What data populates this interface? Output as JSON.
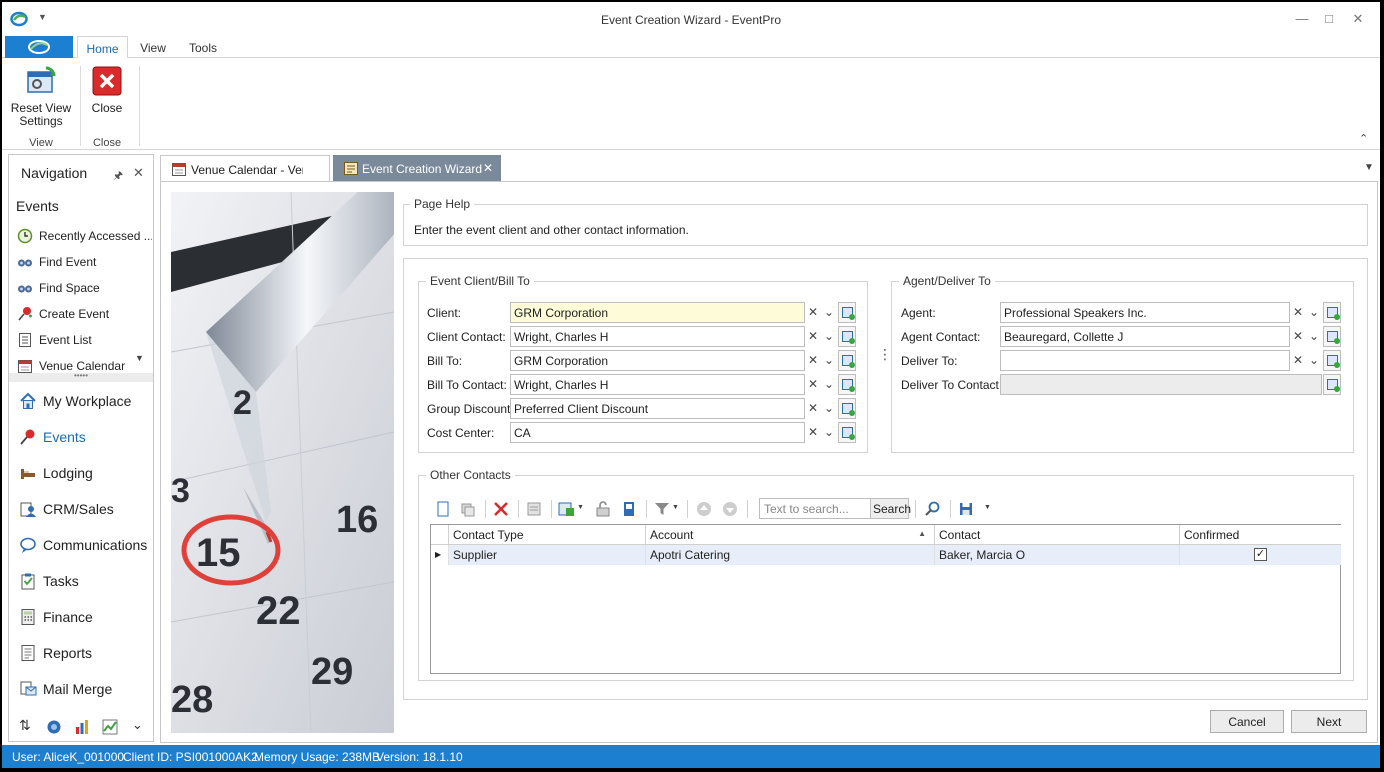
{
  "window": {
    "title": "Event Creation Wizard - EventPro"
  },
  "ribbon": {
    "tabs": [
      {
        "label": "Home"
      },
      {
        "label": "View"
      },
      {
        "label": "Tools"
      }
    ],
    "buttons": {
      "reset_view_line1": "Reset View",
      "reset_view_line2": "Settings",
      "close": "Close"
    },
    "groups": {
      "view": "View",
      "close": "Close"
    }
  },
  "navigation": {
    "title": "Navigation",
    "section": "Events",
    "items": [
      {
        "label": "Recently Accessed ...",
        "icon": "clock-icon"
      },
      {
        "label": "Find Event",
        "icon": "binoculars-icon"
      },
      {
        "label": "Find Space",
        "icon": "binoculars-icon"
      },
      {
        "label": "Create Event",
        "icon": "pin-icon"
      },
      {
        "label": "Event List",
        "icon": "list-icon"
      },
      {
        "label": "Venue Calendar",
        "icon": "calendar-icon"
      }
    ],
    "modules": [
      {
        "label": "My Workplace"
      },
      {
        "label": "Events"
      },
      {
        "label": "Lodging"
      },
      {
        "label": "CRM/Sales"
      },
      {
        "label": "Communications"
      },
      {
        "label": "Tasks"
      },
      {
        "label": "Finance"
      },
      {
        "label": "Reports"
      },
      {
        "label": "Mail Merge"
      }
    ]
  },
  "doc_tabs": [
    {
      "label": "Venue Calendar - Venue"
    },
    {
      "label": "Event Creation Wizard"
    }
  ],
  "page_help": {
    "title": "Page Help",
    "text": "Enter the event client and other contact information."
  },
  "client_group": {
    "title": "Event Client/Bill To",
    "fields": [
      {
        "label": "Client:",
        "value": "GRM Corporation"
      },
      {
        "label": "Client Contact:",
        "value": "Wright, Charles H"
      },
      {
        "label": "Bill To:",
        "value": "GRM Corporation"
      },
      {
        "label": "Bill To Contact:",
        "value": "Wright, Charles H"
      },
      {
        "label": "Group Discount:",
        "value": "Preferred Client Discount"
      },
      {
        "label": "Cost Center:",
        "value": "CA"
      }
    ]
  },
  "agent_group": {
    "title": "Agent/Deliver To",
    "fields": [
      {
        "label": "Agent:",
        "value": "Professional Speakers Inc."
      },
      {
        "label": "Agent Contact:",
        "value": "Beauregard, Collette J"
      },
      {
        "label": "Deliver To:",
        "value": ""
      },
      {
        "label": "Deliver To Contact:",
        "value": ""
      }
    ]
  },
  "other_contacts": {
    "title": "Other Contacts",
    "search_placeholder": "Text to search...",
    "search_button": "Search",
    "columns": [
      "Contact Type",
      "Account",
      "Contact",
      "Confirmed"
    ],
    "rows": [
      {
        "contact_type": "Supplier",
        "account": "Apotri Catering",
        "contact": "Baker, Marcia O",
        "confirmed": "✓"
      }
    ]
  },
  "buttons": {
    "cancel": "Cancel",
    "next": "Next"
  },
  "status": {
    "user": "User: AliceK_001000",
    "client_id": "Client ID: PSI001000AK2",
    "memory": "Memory Usage: 238MB",
    "version": "Version: 18.1.10"
  },
  "photo": {
    "numbers": [
      "2",
      "3",
      "15",
      "16",
      "22",
      "29",
      "28"
    ]
  },
  "colors": {
    "accent": "#1c7fd0",
    "field_highlight": "#fefbd9",
    "row_highlight": "#e7eef9"
  }
}
